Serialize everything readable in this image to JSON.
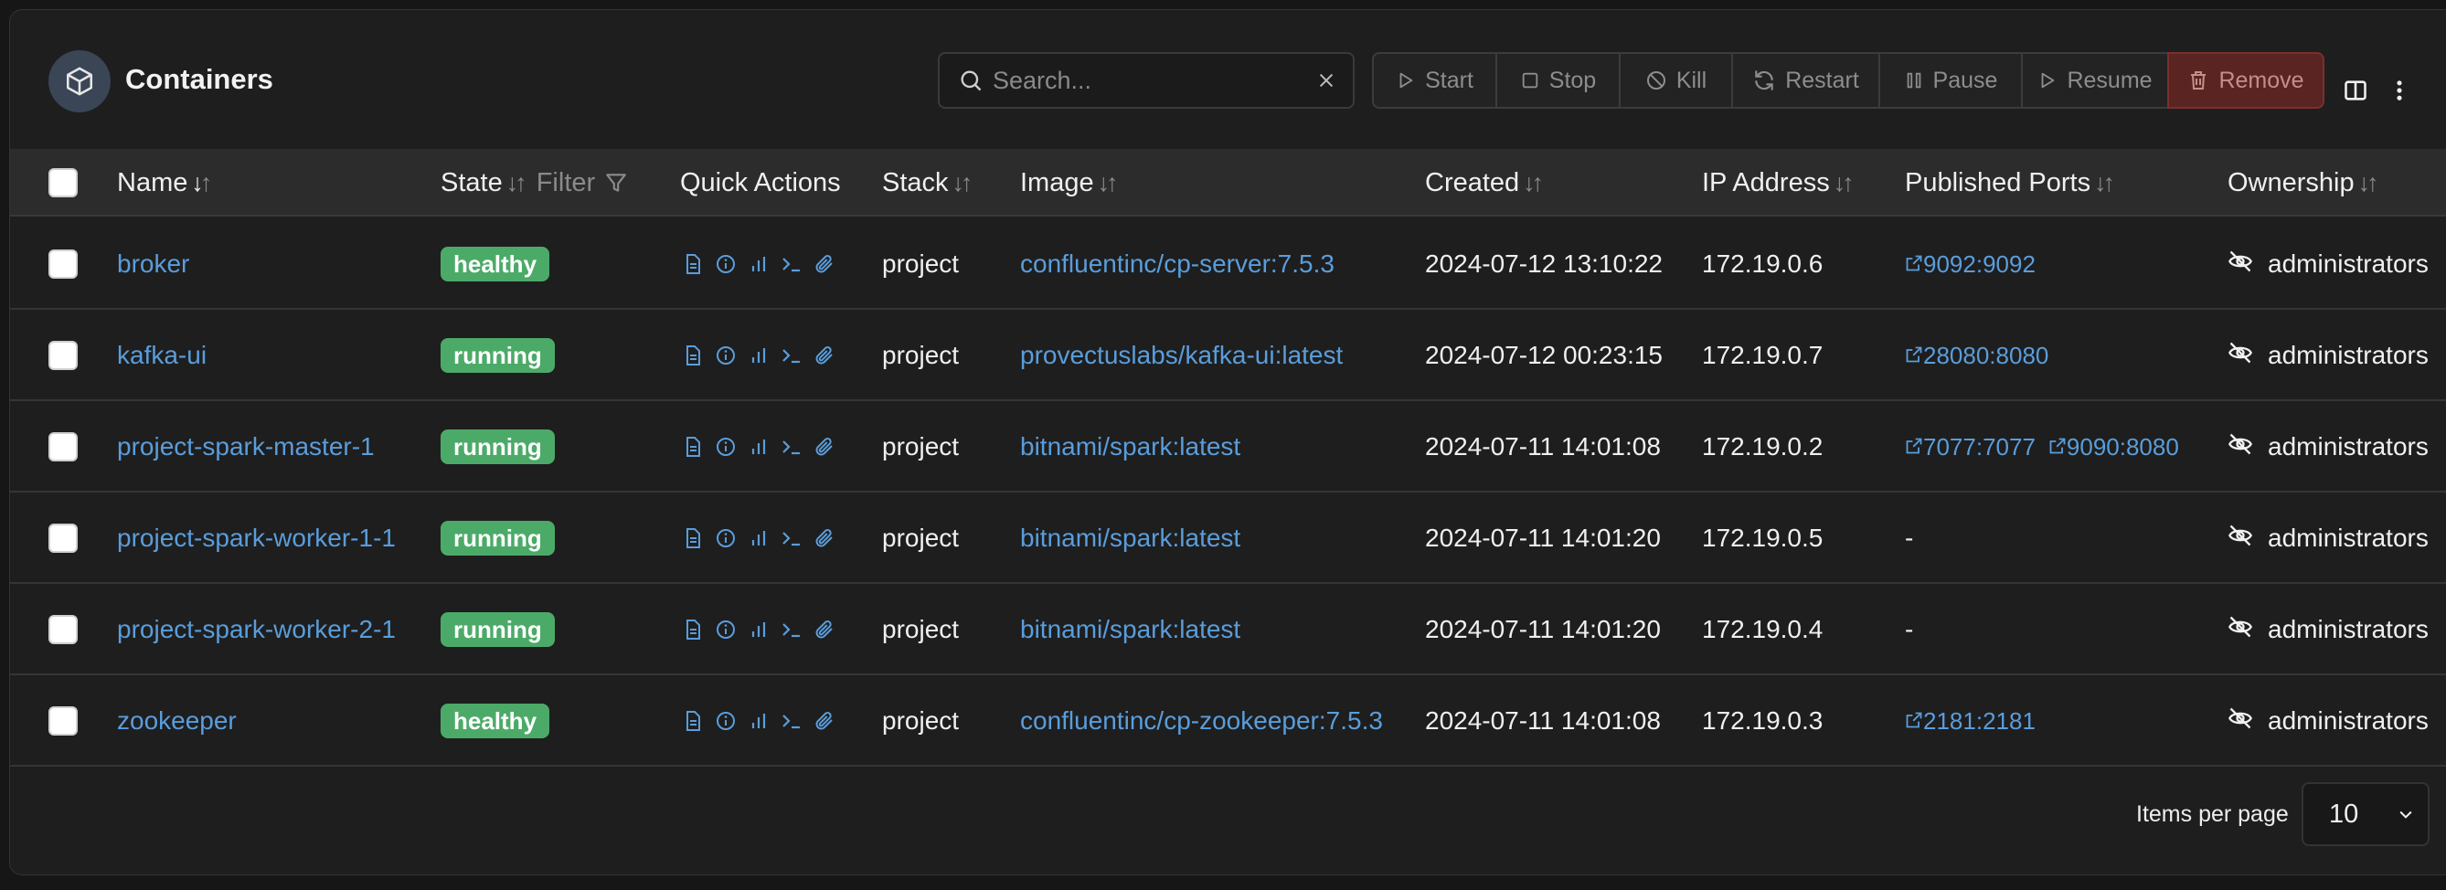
{
  "header": {
    "title": "Containers",
    "icon": "box-icon",
    "search": {
      "placeholder": "Search...",
      "value": ""
    },
    "actions": [
      {
        "label": "Start",
        "icon": "play-icon"
      },
      {
        "label": "Stop",
        "icon": "stop-icon"
      },
      {
        "label": "Kill",
        "icon": "ban-icon"
      },
      {
        "label": "Restart",
        "icon": "refresh-icon"
      },
      {
        "label": "Pause",
        "icon": "pause-icon"
      },
      {
        "label": "Resume",
        "icon": "play-icon"
      },
      {
        "label": "Remove",
        "icon": "trash-icon"
      }
    ]
  },
  "table": {
    "columns": {
      "name": "Name",
      "state": "State",
      "state_filter": "Filter",
      "quick_actions": "Quick Actions",
      "stack": "Stack",
      "image": "Image",
      "created": "Created",
      "ip": "IP Address",
      "ports": "Published Ports",
      "ownership": "Ownership"
    },
    "rows": [
      {
        "name": "broker",
        "state": "healthy",
        "stack": "project",
        "image": "confluentinc/cp-server:7.5.3",
        "created": "2024-07-12 13:10:22",
        "ip": "172.19.0.6",
        "ports": [
          "9092:9092"
        ],
        "ownership": "administrators"
      },
      {
        "name": "kafka-ui",
        "state": "running",
        "stack": "project",
        "image": "provectuslabs/kafka-ui:latest",
        "created": "2024-07-12 00:23:15",
        "ip": "172.19.0.7",
        "ports": [
          "28080:8080"
        ],
        "ownership": "administrators"
      },
      {
        "name": "project-spark-master-1",
        "state": "running",
        "stack": "project",
        "image": "bitnami/spark:latest",
        "created": "2024-07-11 14:01:08",
        "ip": "172.19.0.2",
        "ports": [
          "7077:7077",
          "9090:8080"
        ],
        "ownership": "administrators"
      },
      {
        "name": "project-spark-worker-1-1",
        "state": "running",
        "stack": "project",
        "image": "bitnami/spark:latest",
        "created": "2024-07-11 14:01:20",
        "ip": "172.19.0.5",
        "ports_text": "-",
        "ports": [],
        "ownership": "administrators"
      },
      {
        "name": "project-spark-worker-2-1",
        "state": "running",
        "stack": "project",
        "image": "bitnami/spark:latest",
        "created": "2024-07-11 14:01:20",
        "ip": "172.19.0.4",
        "ports_text": "-",
        "ports": [],
        "ownership": "administrators"
      },
      {
        "name": "zookeeper",
        "state": "healthy",
        "stack": "project",
        "image": "confluentinc/cp-zookeeper:7.5.3",
        "created": "2024-07-11 14:01:08",
        "ip": "172.19.0.3",
        "ports": [
          "2181:2181"
        ],
        "ownership": "administrators"
      }
    ]
  },
  "footer": {
    "items_per_page_label": "Items per page",
    "items_per_page_value": "10"
  },
  "colors": {
    "accent_link": "#5a9ddb",
    "status_green": "#4caa68",
    "remove_red": "#5a2422"
  }
}
